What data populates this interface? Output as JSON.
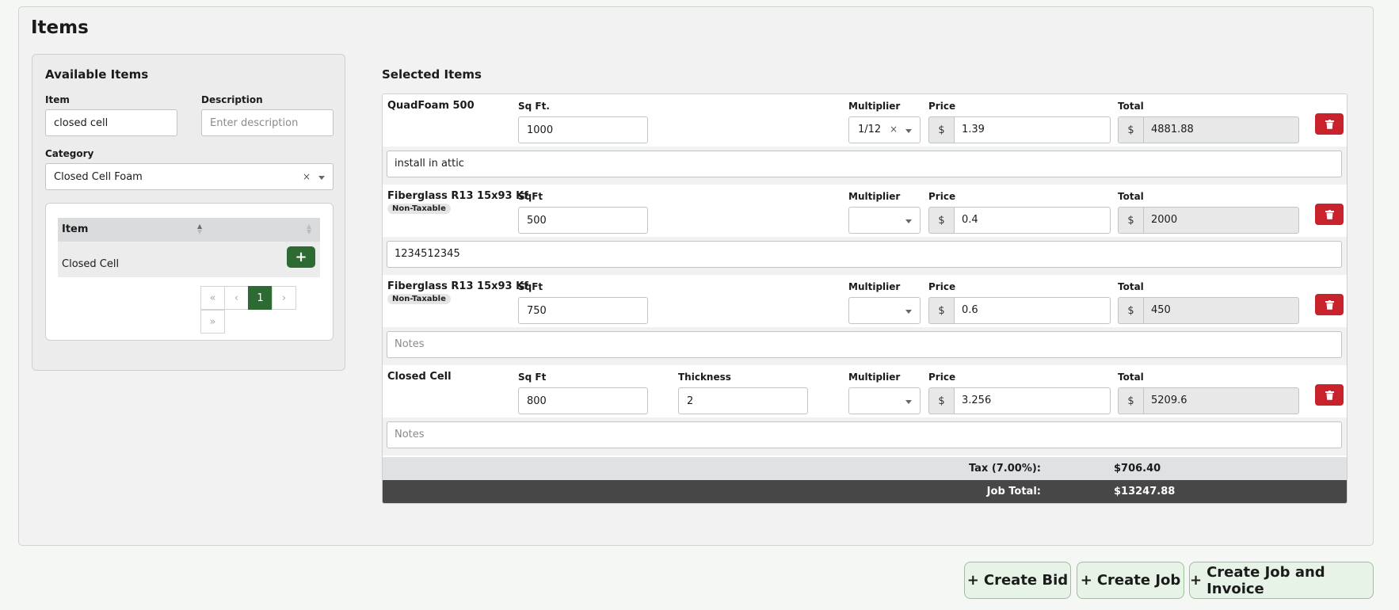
{
  "page": {
    "title": "Items"
  },
  "available": {
    "title": "Available Items",
    "item_label": "Item",
    "item_value": "closed cell",
    "description_label": "Description",
    "description_placeholder": "Enter description",
    "category_label": "Category",
    "category_value": "Closed Cell Foam",
    "category_clear": "×",
    "table": {
      "header": "Item",
      "rows": [
        {
          "name": "Closed Cell",
          "add_label": "+"
        }
      ]
    },
    "pagination": {
      "first": "«",
      "prev": "‹",
      "current": "1",
      "next": "›",
      "last": "»"
    }
  },
  "selected": {
    "title": "Selected Items",
    "items": [
      {
        "name": "QuadFoam 500",
        "badge": "",
        "qty_label": "Sq Ft.",
        "qty_value": "1000",
        "thickness_label": "",
        "thickness_value": "",
        "multiplier_label": "Multiplier",
        "multiplier_value": "1/12",
        "multiplier_clear": "×",
        "price_label": "Price",
        "currency": "$",
        "price_value": "1.39",
        "total_label": "Total",
        "total_value": "4881.88",
        "notes": "install in attic",
        "notes_placeholder": "Notes"
      },
      {
        "name": "Fiberglass R13 15x93 Kf",
        "badge": "Non-Taxable",
        "qty_label": "SqFt",
        "qty_value": "500",
        "thickness_label": "",
        "thickness_value": "",
        "multiplier_label": "Multiplier",
        "multiplier_value": "",
        "multiplier_clear": "",
        "price_label": "Price",
        "currency": "$",
        "price_value": "0.4",
        "total_label": "Total",
        "total_value": "2000",
        "notes": "1234512345",
        "notes_placeholder": "Notes"
      },
      {
        "name": "Fiberglass R13 15x93 Kf",
        "badge": "Non-Taxable",
        "qty_label": "SqFt",
        "qty_value": "750",
        "thickness_label": "",
        "thickness_value": "",
        "multiplier_label": "Multiplier",
        "multiplier_value": "",
        "multiplier_clear": "",
        "price_label": "Price",
        "currency": "$",
        "price_value": "0.6",
        "total_label": "Total",
        "total_value": "450",
        "notes": "",
        "notes_placeholder": "Notes"
      },
      {
        "name": "Closed Cell",
        "badge": "",
        "qty_label": "Sq Ft",
        "qty_value": "800",
        "thickness_label": "Thickness",
        "thickness_value": "2",
        "multiplier_label": "Multiplier",
        "multiplier_value": "",
        "multiplier_clear": "",
        "price_label": "Price",
        "currency": "$",
        "price_value": "3.256",
        "total_label": "Total",
        "total_value": "5209.6",
        "notes": "",
        "notes_placeholder": "Notes"
      }
    ],
    "tax_label": "Tax (7.00%):",
    "tax_value": "$706.40",
    "job_total_label": "Job Total:",
    "job_total_value": "$13247.88"
  },
  "actions": {
    "create_bid": "Create Bid",
    "create_job": "Create Job",
    "create_job_invoice": "Create Job and Invoice",
    "plus": "+"
  },
  "colors": {
    "accent_green": "#2e6b34",
    "delete_red": "#c8232c",
    "total_bar": "#474747"
  },
  "icons": {
    "delete": "trash-icon",
    "add": "plus-icon",
    "sort": "sort-icon",
    "dropdown": "chevron-down-icon"
  }
}
